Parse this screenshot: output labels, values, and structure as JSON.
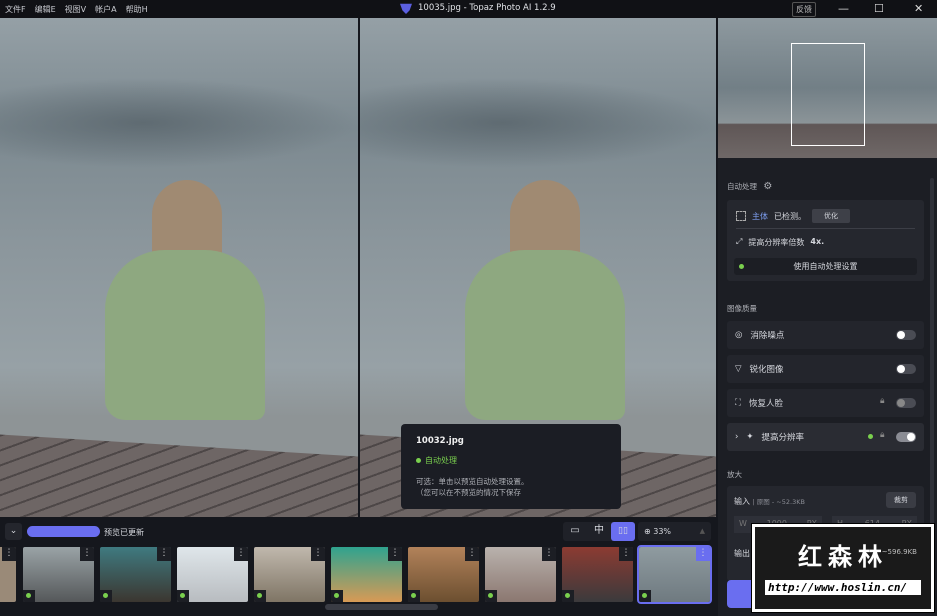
{
  "menu": [
    "文件F",
    "编辑E",
    "视图V",
    "帐户A",
    "帮助H"
  ],
  "window_title": "10035.jpg - Topaz Photo AI 1.2.9",
  "feedback": "反馈",
  "window_controls": {
    "minimize": "—",
    "maximize": "☐",
    "close": "✕"
  },
  "tooltip": {
    "filename": "10032.jpg",
    "status": "自动处理",
    "line1": "可选：单击以预览自动处理设置。",
    "line2": "（您可以在不预览的情况下保存"
  },
  "autopilot": {
    "title": "自动处理",
    "subject": "主体",
    "detected": "已检测。",
    "refine": "优化",
    "upscale_text": "提高分辨率倍数",
    "upscale_factor": "4x.",
    "use_settings": "使用自动处理设置"
  },
  "quality": {
    "title": "图像质量",
    "items": [
      {
        "label": "消除噪点",
        "on": false,
        "locked": false
      },
      {
        "label": "锐化图像",
        "on": false,
        "locked": false
      },
      {
        "label": "恢复人脸",
        "on": false,
        "locked": true
      },
      {
        "label": "提高分辨率",
        "on": true,
        "locked": true
      }
    ]
  },
  "enlarge": {
    "title": "放大",
    "input_label": "输入",
    "input_info": "| 原图 - ~52.3KB",
    "crop": "裁剪",
    "w_label": "W",
    "w_value": "1090",
    "h_label": "H",
    "h_value": "614",
    "unit": "PX",
    "output_label": "输出",
    "output_size": "~596.9KB"
  },
  "bottom": {
    "preview_status": "预览已更新",
    "zoom": "33%",
    "view_modes": [
      "single",
      "split",
      "side-by-side"
    ],
    "active_view": "side-by-side"
  },
  "thumbnails": [
    {
      "c1": "#9aa3a6",
      "c2": "#55585a"
    },
    {
      "c1": "#3f7a80",
      "c2": "#3b3630"
    },
    {
      "c1": "#dfe6ea",
      "c2": "#b8bcc0"
    },
    {
      "c1": "#c0b8ad",
      "c2": "#7f7565"
    },
    {
      "c1": "#2fa38f",
      "c2": "#d89a55"
    },
    {
      "c1": "#b2825a",
      "c2": "#6c4f30"
    },
    {
      "c1": "#b9b2ad",
      "c2": "#8b7770"
    },
    {
      "c1": "#8c3b32",
      "c2": "#3b3a3c"
    },
    {
      "c1": "#8f9ba0",
      "c2": "#6f7a80"
    }
  ],
  "watermark": {
    "title": "红森林",
    "url": "http://www.hoslin.cn/"
  }
}
